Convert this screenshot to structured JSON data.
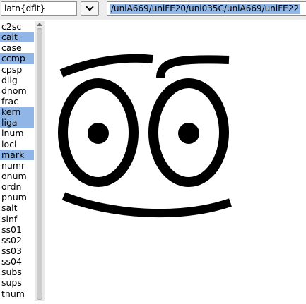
{
  "toolbar": {
    "script_lang": "latn{dflt}",
    "glyph_sequence": "/uniA669/uniFE20/uni035C/uniA669/uniFE22"
  },
  "features": [
    {
      "tag": "c2sc",
      "selected": false
    },
    {
      "tag": "calt",
      "selected": true
    },
    {
      "tag": "case",
      "selected": false
    },
    {
      "tag": "ccmp",
      "selected": true
    },
    {
      "tag": "cpsp",
      "selected": false
    },
    {
      "tag": "dlig",
      "selected": false
    },
    {
      "tag": "dnom",
      "selected": false
    },
    {
      "tag": "frac",
      "selected": false
    },
    {
      "tag": "kern",
      "selected": true
    },
    {
      "tag": "liga",
      "selected": true
    },
    {
      "tag": "lnum",
      "selected": false
    },
    {
      "tag": "locl",
      "selected": false
    },
    {
      "tag": "mark",
      "selected": true
    },
    {
      "tag": "numr",
      "selected": false
    },
    {
      "tag": "onum",
      "selected": false
    },
    {
      "tag": "ordn",
      "selected": false
    },
    {
      "tag": "pnum",
      "selected": false
    },
    {
      "tag": "salt",
      "selected": false
    },
    {
      "tag": "sinf",
      "selected": false
    },
    {
      "tag": "ss01",
      "selected": false
    },
    {
      "tag": "ss02",
      "selected": false
    },
    {
      "tag": "ss03",
      "selected": false
    },
    {
      "tag": "ss04",
      "selected": false
    },
    {
      "tag": "subs",
      "selected": false
    },
    {
      "tag": "sups",
      "selected": false
    },
    {
      "tag": "tnum",
      "selected": false
    }
  ],
  "colors": {
    "selection": "#8fb6e6",
    "glyph": "#000000"
  },
  "icons": {
    "dropdown": "chevron-down-icon"
  }
}
